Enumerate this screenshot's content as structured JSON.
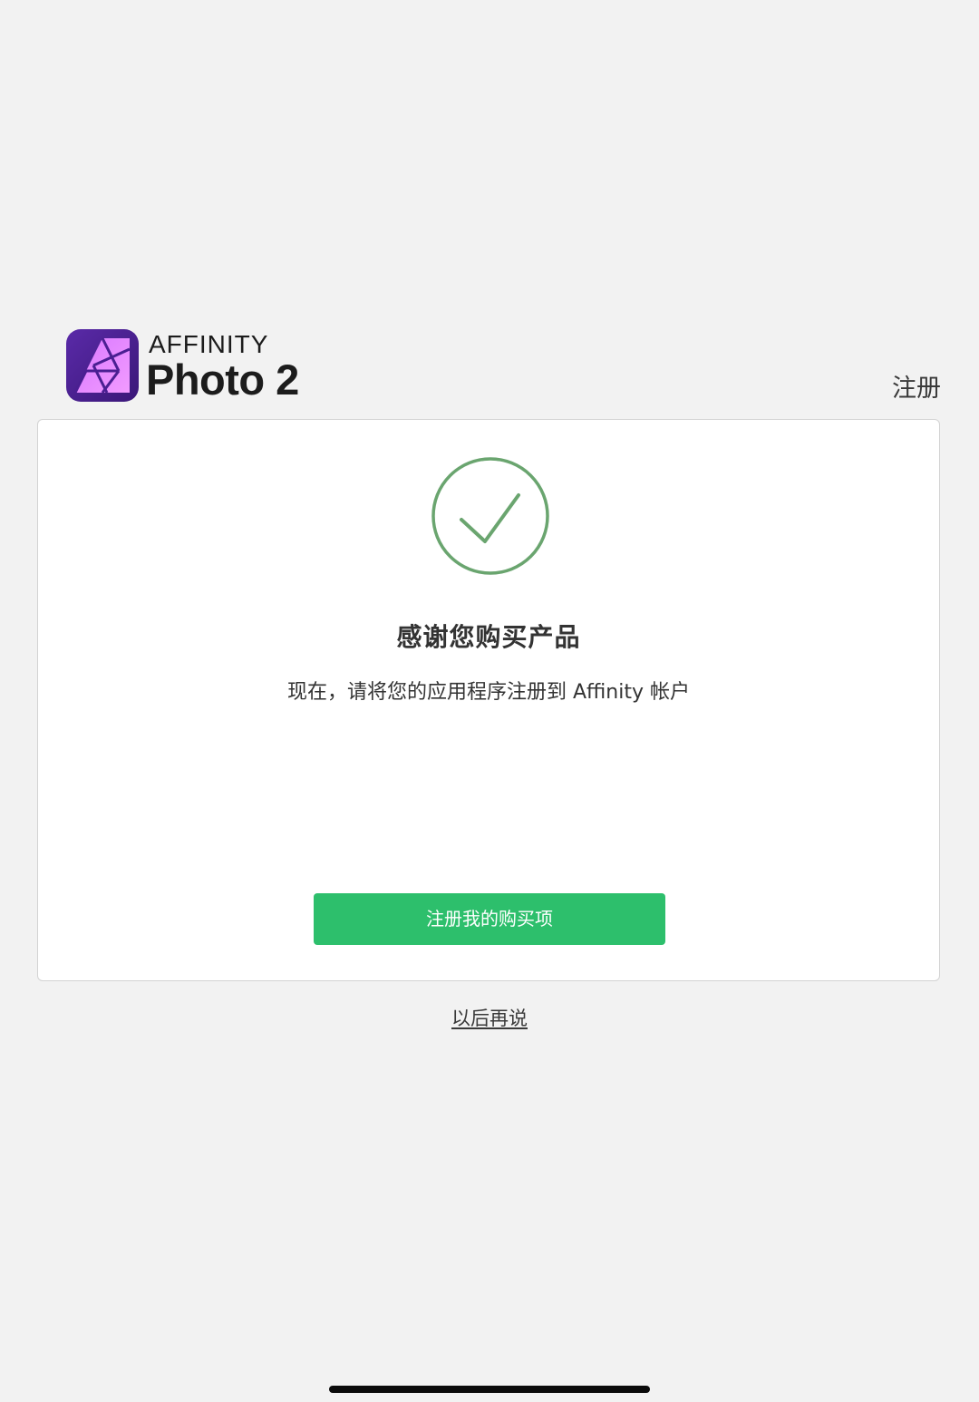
{
  "header": {
    "brand_small": "AFFINITY",
    "brand_large": "Photo 2",
    "logo_icon": "affinity-photo-aperture-icon",
    "register_link": "注册"
  },
  "card": {
    "status_icon": "checkmark-circle-icon",
    "title": "感谢您购买产品",
    "subtitle": "现在，请将您的应用程序注册到 Affinity 帐户",
    "primary_button": "注册我的购买项"
  },
  "footer": {
    "later_link": "以后再说"
  },
  "colors": {
    "background": "#f2f2f2",
    "card_background": "#ffffff",
    "success_green": "#6aa56f",
    "button_green": "#2dbf6c",
    "brand_purple": "#7a3fc0"
  }
}
